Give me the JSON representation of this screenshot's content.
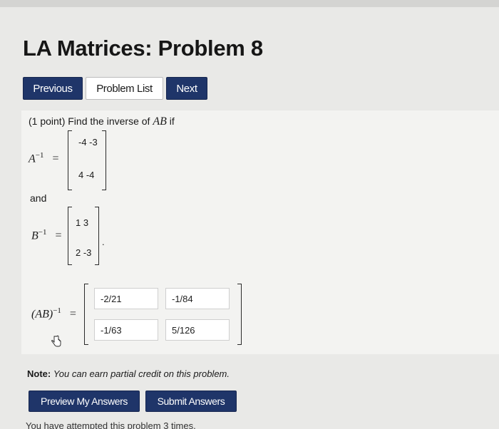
{
  "page": {
    "title": "LA Matrices: Problem 8"
  },
  "nav": {
    "previous": "Previous",
    "problem_list": "Problem List",
    "next": "Next"
  },
  "problem": {
    "points": "(1 point) Find the inverse of",
    "ab": "AB",
    "if": "if",
    "and": "and",
    "a_inv": {
      "base": "A",
      "exp": "−1",
      "eq": "=",
      "rows": [
        "-4 -3",
        "4 -4"
      ]
    },
    "b_inv": {
      "base": "B",
      "exp": "−1",
      "eq": "=",
      "rows": [
        "1 3",
        "2 -3"
      ],
      "period": "."
    },
    "ab_inv": {
      "base": "(AB)",
      "exp": "−1",
      "eq": "=",
      "answers": [
        "-2/21",
        "-1/84",
        "-1/63",
        "5/126"
      ]
    }
  },
  "note": {
    "label": "Note:",
    "text": "You can earn partial credit on this problem."
  },
  "actions": {
    "preview": "Preview My Answers",
    "submit": "Submit Answers"
  },
  "attempts": "You have attempted this problem 3 times.",
  "colors": {
    "button_bg": "#1f3569",
    "page_bg": "#e9e9e7",
    "problem_bg": "#f3f3f1"
  },
  "icons": {
    "cursor": "hand-pointer-icon"
  }
}
